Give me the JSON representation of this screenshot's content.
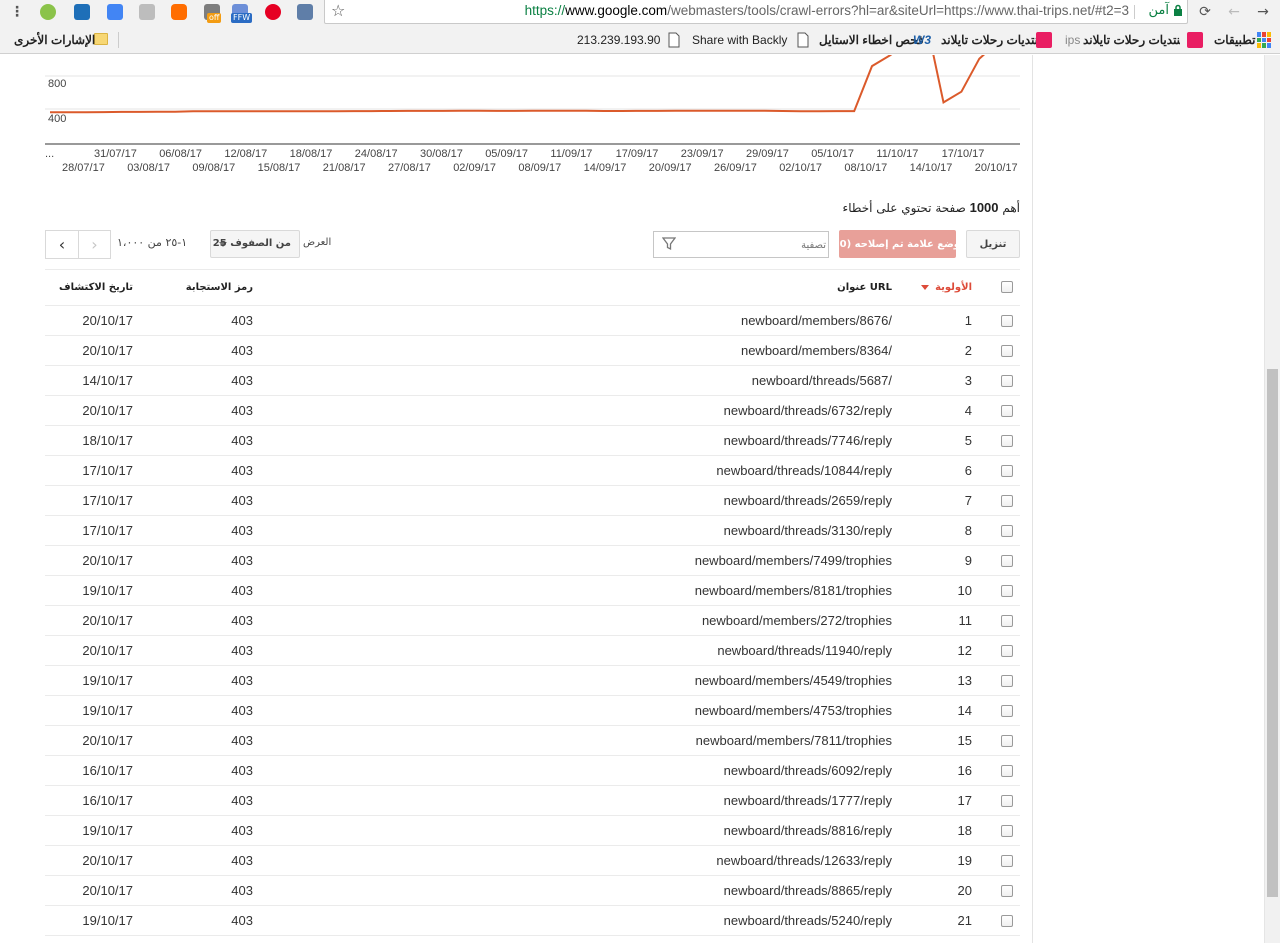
{
  "browser": {
    "url_scheme": "https://",
    "url_host": "www.google.com",
    "url_rest": "/webmasters/tools/crawl-errors?hl=ar&siteUrl=https://www.thai-trips.net/#t2=3",
    "secure_label": "آمن",
    "extensions": {
      "off_badge": "off",
      "ffw_badge": "FFW"
    }
  },
  "bookmarks": {
    "apps": "تطبيقات",
    "item1": "منتديات رحلات تايلاند | ...",
    "item1_tail": "ips",
    "item2": "منتديات رحلات تايلاند",
    "item3": "فحص اخطاء الاستايل",
    "item3_icon": "W3",
    "item4": "Share with Backly",
    "item5": "213.239.193.90",
    "other": "الإشارات الأخرى"
  },
  "chart_data": {
    "type": "line",
    "yticks": [
      "800",
      "400"
    ],
    "x_top": [
      "31/07/17",
      "06/08/17",
      "12/08/17",
      "18/08/17",
      "24/08/17",
      "30/08/17",
      "05/09/17",
      "11/09/17",
      "17/09/17",
      "23/09/17",
      "29/09/17",
      "05/10/17",
      "11/10/17",
      "17/10/17"
    ],
    "x_bottom": [
      "28/07/17",
      "03/08/17",
      "09/08/17",
      "15/08/17",
      "21/08/17",
      "27/08/17",
      "02/09/17",
      "08/09/17",
      "14/09/17",
      "20/09/17",
      "26/09/17",
      "02/10/17",
      "08/10/17",
      "14/10/17",
      "20/10/17"
    ],
    "x_prefix": "...",
    "color": "#db5a2b",
    "values": [
      360,
      360,
      360,
      362,
      365,
      365,
      366,
      367,
      372,
      373,
      373,
      373,
      372,
      372,
      372,
      373,
      373,
      375,
      375,
      376,
      377,
      377,
      377,
      378,
      378,
      377,
      377,
      378,
      379,
      379,
      378,
      376,
      376,
      377,
      377,
      378,
      378,
      379,
      378,
      378,
      378,
      376,
      372,
      373,
      374,
      375,
      920,
      1050,
      1200,
      1500,
      480,
      610,
      1010,
      1200,
      1350
    ]
  },
  "summary": {
    "prefix": "أهم",
    "count": "1000",
    "suffix": "صفحة تحتوي على أخطاء"
  },
  "controls": {
    "download": "تنزيل",
    "mark_fixed": "وضع علامة تم إصلاحه (0)",
    "filter_placeholder": "تصفية",
    "show": "العرض",
    "rows_select": "25 من الصفوف",
    "page_range": "١-٢٥ من ١،٠٠٠"
  },
  "table": {
    "headers": {
      "priority": "الأولوية",
      "url": "عنوان URL",
      "response_code": "رمز الاستجابة",
      "detected": "تاريخ الاكتشاف"
    },
    "rows": [
      {
        "priority": "1",
        "url": "newboard/members/8676/",
        "code": "403",
        "date": "20/10/17"
      },
      {
        "priority": "2",
        "url": "newboard/members/8364/",
        "code": "403",
        "date": "20/10/17"
      },
      {
        "priority": "3",
        "url": "newboard/threads/5687/",
        "code": "403",
        "date": "14/10/17"
      },
      {
        "priority": "4",
        "url": "newboard/threads/6732/reply",
        "code": "403",
        "date": "20/10/17"
      },
      {
        "priority": "5",
        "url": "newboard/threads/7746/reply",
        "code": "403",
        "date": "18/10/17"
      },
      {
        "priority": "6",
        "url": "newboard/threads/10844/reply",
        "code": "403",
        "date": "17/10/17"
      },
      {
        "priority": "7",
        "url": "newboard/threads/2659/reply",
        "code": "403",
        "date": "17/10/17"
      },
      {
        "priority": "8",
        "url": "newboard/threads/3130/reply",
        "code": "403",
        "date": "17/10/17"
      },
      {
        "priority": "9",
        "url": "newboard/members/7499/trophies",
        "code": "403",
        "date": "20/10/17"
      },
      {
        "priority": "10",
        "url": "newboard/members/8181/trophies",
        "code": "403",
        "date": "19/10/17"
      },
      {
        "priority": "11",
        "url": "newboard/members/272/trophies",
        "code": "403",
        "date": "20/10/17"
      },
      {
        "priority": "12",
        "url": "newboard/threads/11940/reply",
        "code": "403",
        "date": "20/10/17"
      },
      {
        "priority": "13",
        "url": "newboard/members/4549/trophies",
        "code": "403",
        "date": "19/10/17"
      },
      {
        "priority": "14",
        "url": "newboard/members/4753/trophies",
        "code": "403",
        "date": "19/10/17"
      },
      {
        "priority": "15",
        "url": "newboard/members/7811/trophies",
        "code": "403",
        "date": "20/10/17"
      },
      {
        "priority": "16",
        "url": "newboard/threads/6092/reply",
        "code": "403",
        "date": "16/10/17"
      },
      {
        "priority": "17",
        "url": "newboard/threads/1777/reply",
        "code": "403",
        "date": "16/10/17"
      },
      {
        "priority": "18",
        "url": "newboard/threads/8816/reply",
        "code": "403",
        "date": "19/10/17"
      },
      {
        "priority": "19",
        "url": "newboard/threads/12633/reply",
        "code": "403",
        "date": "20/10/17"
      },
      {
        "priority": "20",
        "url": "newboard/threads/8865/reply",
        "code": "403",
        "date": "20/10/17"
      },
      {
        "priority": "21",
        "url": "newboard/threads/5240/reply",
        "code": "403",
        "date": "19/10/17"
      }
    ]
  }
}
